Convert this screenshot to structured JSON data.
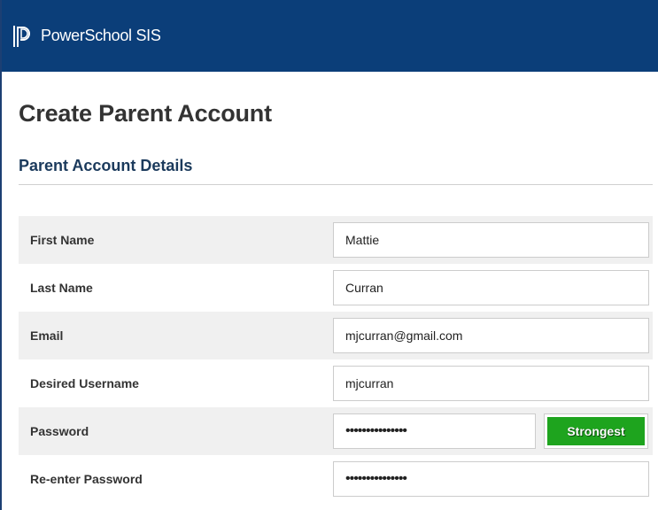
{
  "app": {
    "brand": "PowerSchool SIS",
    "logo_icon": "powerschool-logo-icon",
    "header_color": "#0b3e79"
  },
  "page": {
    "title": "Create Parent Account",
    "section_title": "Parent Account Details"
  },
  "form": {
    "first_name": {
      "label": "First Name",
      "value": "Mattie"
    },
    "last_name": {
      "label": "Last Name",
      "value": "Curran"
    },
    "email": {
      "label": "Email",
      "value": "mjcurran@gmail.com"
    },
    "username": {
      "label": "Desired Username",
      "value": "mjcurran"
    },
    "password": {
      "label": "Password",
      "value": "•••••••••••••••"
    },
    "password_strength": {
      "label": "Strongest",
      "color": "#1ea41e"
    },
    "reenter_password": {
      "label": "Re-enter Password",
      "value": "•••••••••••••••"
    }
  }
}
